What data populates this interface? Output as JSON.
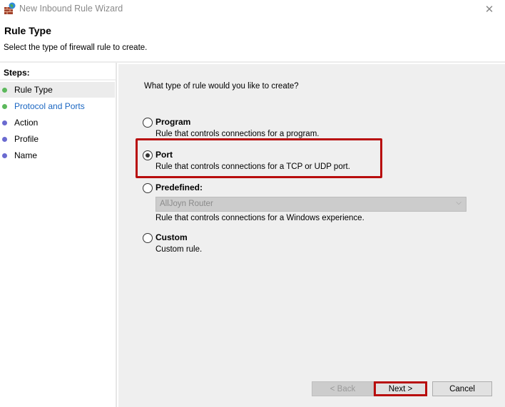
{
  "window": {
    "title": "New Inbound Rule Wizard",
    "close_label": "✕"
  },
  "header": {
    "title": "Rule Type",
    "subtitle": "Select the type of firewall rule to create."
  },
  "steps": {
    "heading": "Steps:",
    "items": [
      {
        "label": "Rule Type",
        "state": "current",
        "dot_color": "#4caf50"
      },
      {
        "label": "Protocol and Ports",
        "state": "link",
        "dot_color": "#4caf50"
      },
      {
        "label": "Action",
        "state": "pending",
        "dot_color": "#5b5bc8"
      },
      {
        "label": "Profile",
        "state": "pending",
        "dot_color": "#5b5bc8"
      },
      {
        "label": "Name",
        "state": "pending",
        "dot_color": "#5b5bc8"
      }
    ]
  },
  "content": {
    "question": "What type of rule would you like to create?",
    "options": [
      {
        "label": "Program",
        "description": "Rule that controls connections for a program.",
        "selected": false
      },
      {
        "label": "Port",
        "description": "Rule that controls connections for a TCP or UDP port.",
        "selected": true
      },
      {
        "label": "Predefined:",
        "description": "Rule that controls connections for a Windows experience.",
        "selected": false
      },
      {
        "label": "Custom",
        "description": "Custom rule.",
        "selected": false
      }
    ],
    "predefined_dropdown": {
      "value": "AllJoyn Router",
      "enabled": false,
      "arrow": "⌵"
    }
  },
  "buttons": {
    "back": "< Back",
    "next": "Next >",
    "cancel": "Cancel"
  },
  "colors": {
    "highlight": "#b80d0d",
    "link": "#1a66c2"
  }
}
